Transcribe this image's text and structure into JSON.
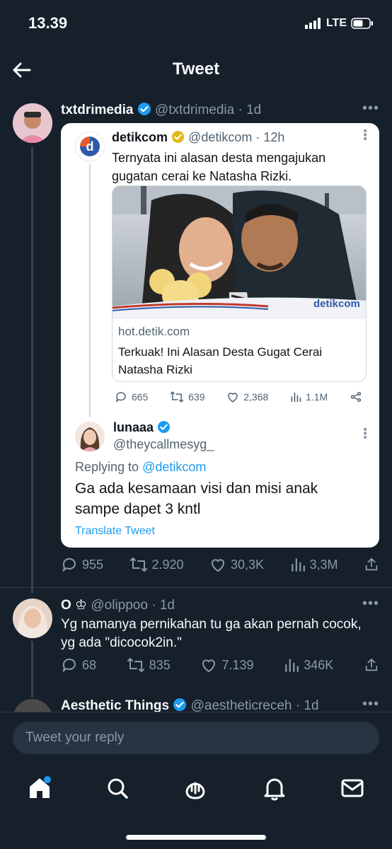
{
  "status": {
    "time": "13.39",
    "network": "LTE"
  },
  "header": {
    "title": "Tweet"
  },
  "main_tweet": {
    "display_name": "txtdrimedia",
    "handle": "@txtdrimedia",
    "time": "· 1d"
  },
  "quoted_tweet": {
    "display_name": "detikcom",
    "handle": "@detikcom",
    "time": "· 12h",
    "text_line1": "Ternyata ini alasan desta mengajukan",
    "text_line2": "gugatan cerai ke Natasha Rizki.",
    "image_watermark": "detikcom",
    "link_domain": "hot.detik.com",
    "link_title_line1": "Terkuak! Ini Alasan Desta Gugat Cerai",
    "link_title_line2": "Natasha Rizki",
    "replies": "665",
    "retweets": "639",
    "likes": "2,368",
    "views": "1.1M"
  },
  "quoted_reply": {
    "display_name": "lunaaa",
    "handle": "@theycallmesyg_",
    "replying_prefix": "Replying to",
    "replying_to": "@detikcom",
    "text_line1": "Ga ada kesamaan visi dan misi anak",
    "text_line2": "sampe dapet 3 kntl",
    "translate": "Translate Tweet"
  },
  "main_actions": {
    "replies": "955",
    "retweets": "2.920",
    "likes": "30,3K",
    "views": "3,3M"
  },
  "reply1": {
    "display_name": "O ♔",
    "handle": "@olippoo",
    "time": "· 1d",
    "text_line1": "Yg namanya pernikahan tu ga akan pernah cocok,",
    "text_line2": "yg ada \"dicocok2in.\"",
    "replies": "68",
    "retweets": "835",
    "likes": "7.139",
    "views": "346K"
  },
  "reply2": {
    "display_name": "Aesthetic Things",
    "handle": "@aestheticreceh",
    "time": "· 1d"
  },
  "composer": {
    "placeholder": "Tweet your reply"
  },
  "colors": {
    "background": "#15202b",
    "accent": "#1d9bf0",
    "verified_gold": "#e2b719"
  }
}
